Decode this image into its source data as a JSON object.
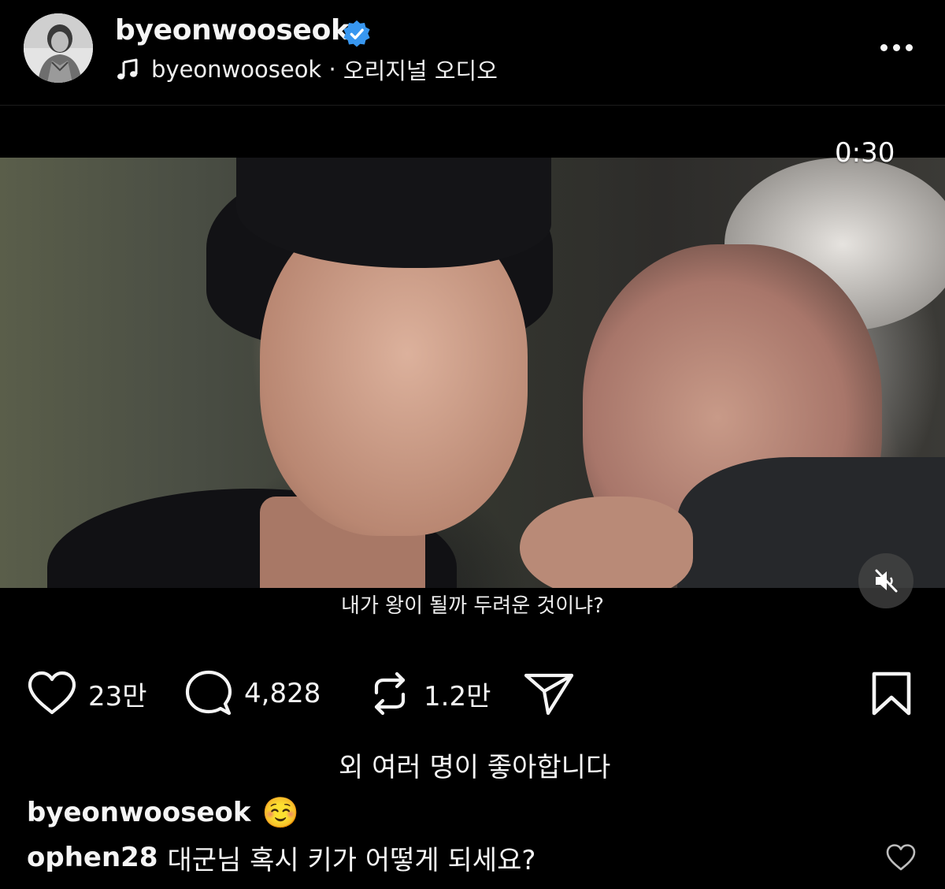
{
  "header": {
    "username": "byeonwooseok",
    "verified_icon": "verified-badge-icon",
    "audio_owner": "byeonwooseok",
    "audio_separator": " · ",
    "audio_title": "오리지널 오디오",
    "more_icon": "more-dots-icon"
  },
  "media": {
    "timer": "0:30",
    "subtitle": "내가 왕이 될까 두려운 것이냐?",
    "mute_icon": "speaker-muted-icon"
  },
  "actions": {
    "likes": "23만",
    "comments": "4,828",
    "reposts": "1.2만",
    "like_icon": "heart-icon",
    "comment_icon": "comment-bubble-icon",
    "repost_icon": "repost-icon",
    "share_icon": "send-icon",
    "save_icon": "bookmark-icon"
  },
  "likes_summary": {
    "text": "외 여러 명이 좋아합니다"
  },
  "caption": {
    "username": "byeonwooseok",
    "emoji": "☺️"
  },
  "comment": {
    "username": "ophen28",
    "text": "대군님 혹시 키가 어떻게 되세요?",
    "like_icon": "heart-outline-icon"
  },
  "colors": {
    "background": "#000000",
    "text": "#f5f5f5",
    "verified": "#3897f0"
  }
}
